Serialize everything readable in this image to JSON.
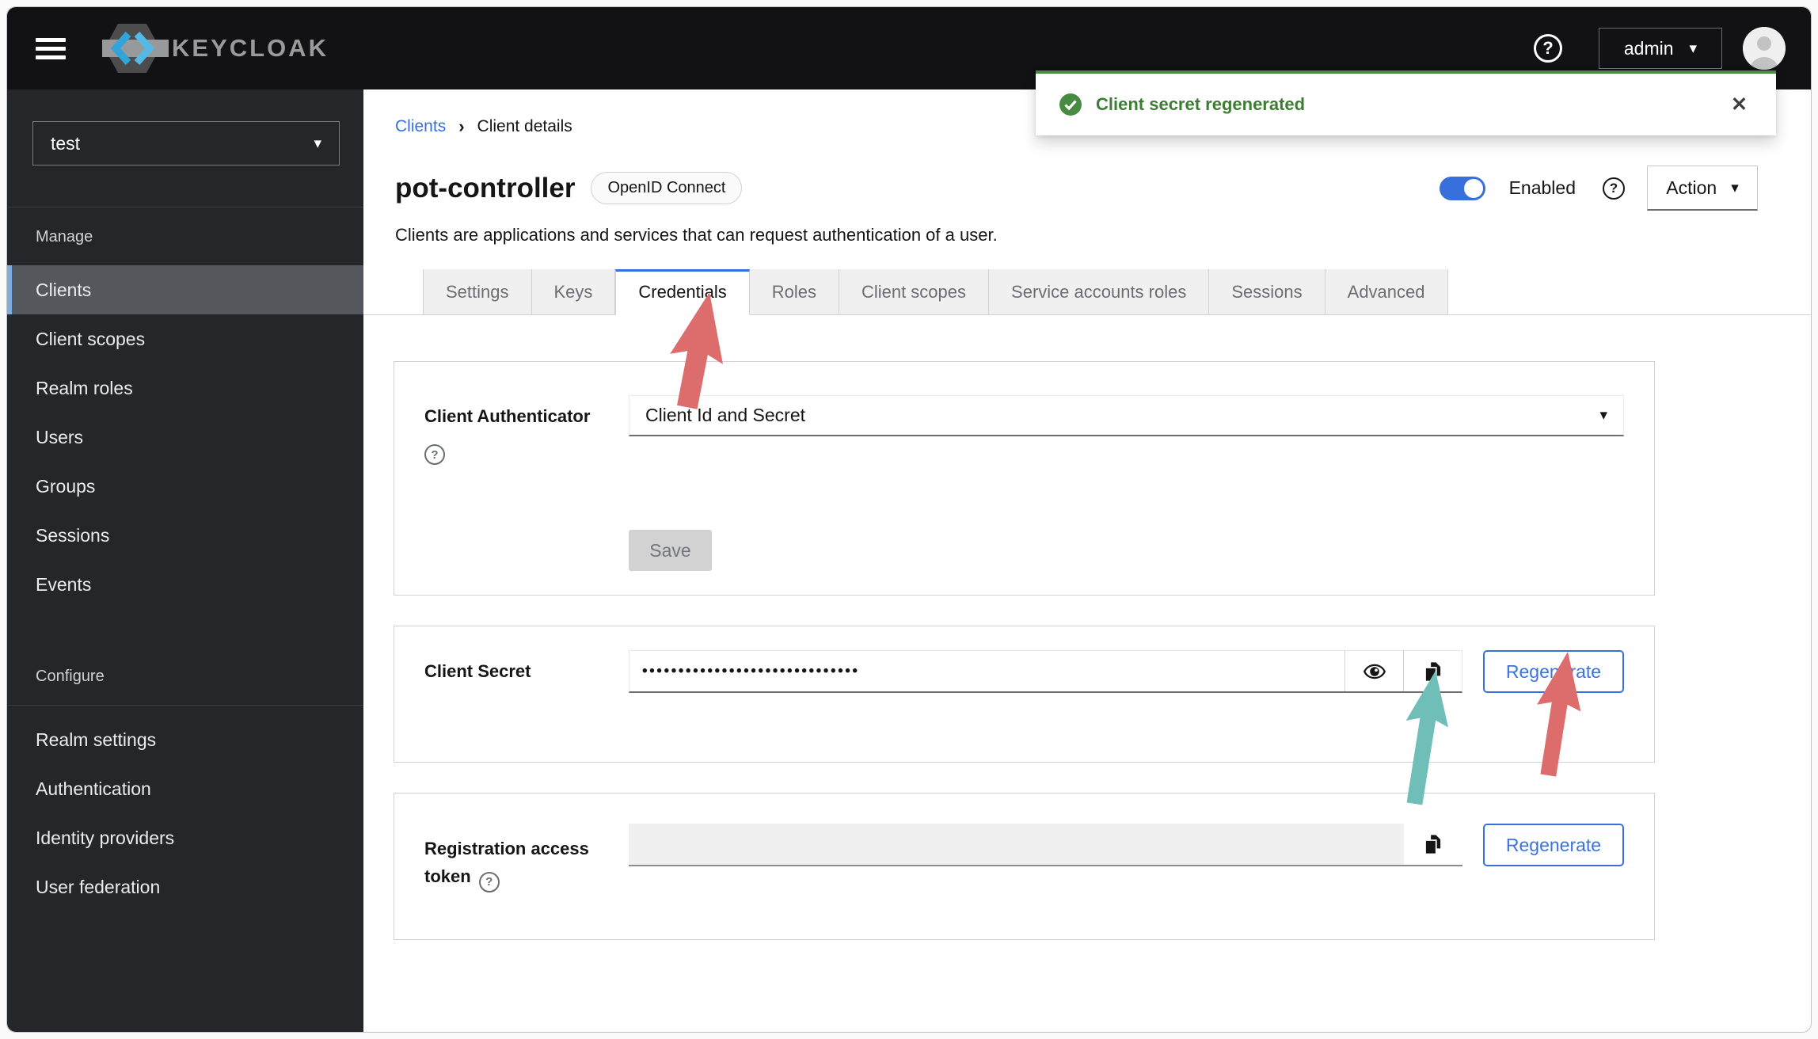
{
  "glyphs": {
    "caret_down": "▾",
    "breadcrumb_sep": "›",
    "close": "✕",
    "question": "?"
  },
  "header": {
    "brand": "KEYCLOAK",
    "username": "admin"
  },
  "toast": {
    "message": "Client secret regenerated"
  },
  "sidebar": {
    "realm": "test",
    "sections": [
      {
        "title": "Manage",
        "items": [
          "Clients",
          "Client scopes",
          "Realm roles",
          "Users",
          "Groups",
          "Sessions",
          "Events"
        ]
      },
      {
        "title": "Configure",
        "items": [
          "Realm settings",
          "Authentication",
          "Identity providers",
          "User federation"
        ]
      }
    ],
    "selected_item": "Clients"
  },
  "breadcrumb": {
    "link": "Clients",
    "current": "Client details"
  },
  "page": {
    "title": "pot-controller",
    "badge": "OpenID Connect",
    "description": "Clients are applications and services that can request authentication of a user.",
    "enabled": true,
    "enabled_label": "Enabled",
    "action_label": "Action"
  },
  "tabs": {
    "items": [
      "Settings",
      "Keys",
      "Credentials",
      "Roles",
      "Client scopes",
      "Service accounts roles",
      "Sessions",
      "Advanced"
    ],
    "active": "Credentials"
  },
  "credentials_form": {
    "client_authenticator_label": "Client Authenticator",
    "client_authenticator_value": "Client Id and Secret",
    "save_label": "Save",
    "client_secret_label": "Client Secret",
    "client_secret_masked": "••••••••••••••••••••••••••••••",
    "regenerate_label": "Regenerate",
    "registration_token_label": "Registration access token",
    "registration_token_value": ""
  },
  "colors": {
    "accent_blue": "#3770dd",
    "success_green": "#478b41",
    "arrow_red": "#dd6d6d",
    "arrow_teal": "#6fbfb8",
    "sidebar_selected_accent": "#7fadde"
  }
}
